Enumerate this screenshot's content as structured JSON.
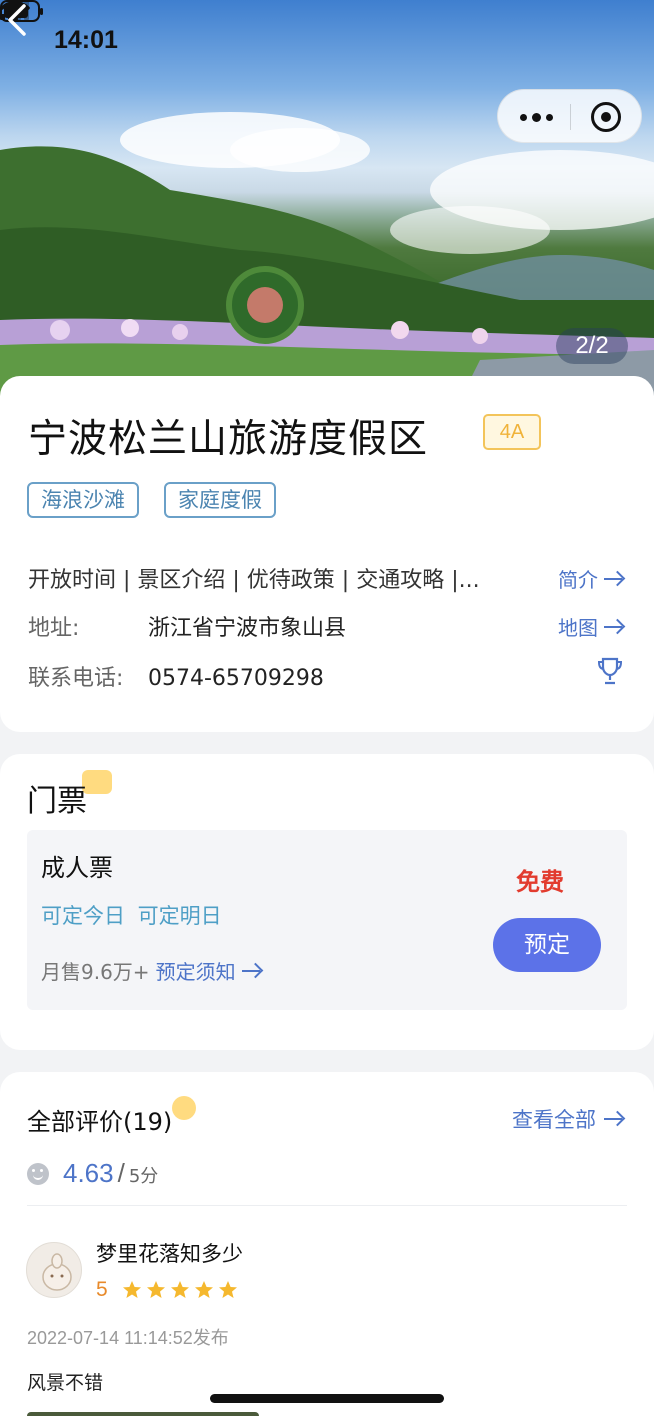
{
  "status_bar": {
    "time": "14:01"
  },
  "hero": {
    "pager": "2/2"
  },
  "info": {
    "title": "宁波松兰山旅游度假区",
    "grade": "4A",
    "tags": [
      "海浪沙滩",
      "家庭度假"
    ],
    "links_row": "开放时间 | 景区介绍 | 优待政策 | 交通攻略 |...",
    "intro_link": "简介",
    "address_label": "地址:",
    "address": "浙江省宁波市象山县",
    "map_link": "地图",
    "phone_label": "联系电话:",
    "phone": "0574-65709298"
  },
  "tickets": {
    "section_title": "门票",
    "name": "成人票",
    "booking": "可定今日 可定明日",
    "sales": "月售9.6万+",
    "notice": "预定须知",
    "price": "免费",
    "book_button": "预定"
  },
  "reviews": {
    "section_title": "全部评价(19)",
    "view_all": "查看全部",
    "score": "4.63",
    "score_slash": "/",
    "score_max": "5分",
    "items": [
      {
        "user": "梦里花落知多少",
        "rating": "5",
        "stars": 5,
        "date": "2022-07-14 11:14:52发布",
        "text": "风景不错"
      }
    ]
  },
  "colors": {
    "accent": "#5c72e8",
    "link": "#4d74c8",
    "price": "#e23b2e",
    "tag": "#4b84b0"
  }
}
